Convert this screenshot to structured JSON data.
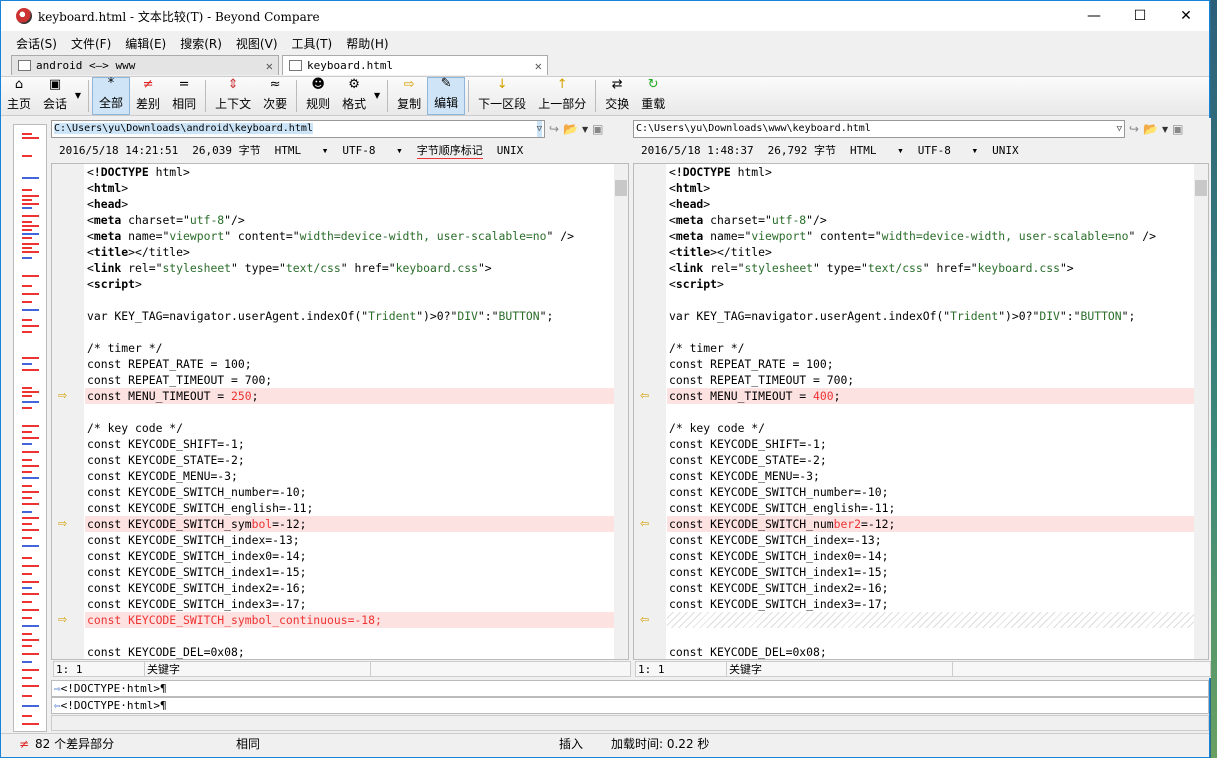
{
  "window": {
    "title": "keyboard.html - 文本比较(T) - Beyond Compare",
    "minimize": "—",
    "maximize": "☐",
    "close": "✕"
  },
  "menu": [
    "会话(S)",
    "文件(F)",
    "编辑(E)",
    "搜索(R)",
    "视图(V)",
    "工具(T)",
    "帮助(H)"
  ],
  "tabs": [
    {
      "label": "android <—> www",
      "close": "✕"
    },
    {
      "label": "keyboard.html",
      "close": "✕"
    }
  ],
  "toolbar": [
    {
      "label": "主页",
      "icon": "⌂"
    },
    {
      "label": "会话",
      "icon": "▣"
    },
    {
      "label": "全部",
      "icon": "*"
    },
    {
      "label": "差别",
      "icon": "≠"
    },
    {
      "label": "相同",
      "icon": "="
    },
    {
      "label": "上下文",
      "icon": "⇕"
    },
    {
      "label": "次要",
      "icon": "≈"
    },
    {
      "label": "规则",
      "icon": "☻"
    },
    {
      "label": "格式",
      "icon": "⚙"
    },
    {
      "label": "复制",
      "icon": "⇨"
    },
    {
      "label": "编辑",
      "icon": "✎"
    },
    {
      "label": "下一区段",
      "icon": "↓"
    },
    {
      "label": "上一部分",
      "icon": "↑"
    },
    {
      "label": "交换",
      "icon": "⇄"
    },
    {
      "label": "重载",
      "icon": "↻"
    }
  ],
  "left": {
    "path": "C:\\Users\\yu\\Downloads\\android\\keyboard.html",
    "date": "2016/5/18 14:21:51",
    "size": "26,039 字节",
    "format": "HTML",
    "encoding": "UTF-8",
    "bom": "字节顺序标记",
    "lineend": "UNIX",
    "pos": "1: 1",
    "keyword": "关键字"
  },
  "right": {
    "path": "C:\\Users\\yu\\Downloads\\www\\keyboard.html",
    "date": "2016/5/18 1:48:37",
    "size": "26,792 字节",
    "format": "HTML",
    "encoding": "UTF-8",
    "lineend": "UNIX",
    "pos": "1: 1",
    "keyword": "关键字"
  },
  "code_common": [
    "<!DOCTYPE html>",
    "<html>",
    "<head>",
    "<meta charset=\"utf-8\"/>",
    "<meta name=\"viewport\" content=\"width=device-width, user-scalable=no\" />",
    "<title></title>",
    "<link rel=\"stylesheet\" type=\"text/css\" href=\"keyboard.css\">",
    "<script>",
    "",
    "var KEY_TAG=navigator.userAgent.indexOf(\"Trident\")>0?\"DIV\":\"BUTTON\";",
    "",
    "/* timer */",
    "const REPEAT_RATE = 100;",
    "const REPEAT_TIMEOUT = 700;"
  ],
  "left_lines": [
    "const MENU_TIMEOUT = 250;",
    "",
    "/* key code */",
    "const KEYCODE_SHIFT=-1;",
    "const KEYCODE_STATE=-2;",
    "const KEYCODE_MENU=-3;",
    "const KEYCODE_SWITCH_number=-10;",
    "const KEYCODE_SWITCH_english=-11;",
    "const KEYCODE_SWITCH_symbol=-12;",
    "const KEYCODE_SWITCH_index=-13;",
    "const KEYCODE_SWITCH_index0=-14;",
    "const KEYCODE_SWITCH_index1=-15;",
    "const KEYCODE_SWITCH_index2=-16;",
    "const KEYCODE_SWITCH_index3=-17;",
    "const KEYCODE_SWITCH_symbol_continuous=-18;",
    "",
    "const KEYCODE_DEL=0x08;"
  ],
  "right_lines": [
    "const MENU_TIMEOUT = 400;",
    "",
    "/* key code */",
    "const KEYCODE_SHIFT=-1;",
    "const KEYCODE_STATE=-2;",
    "const KEYCODE_MENU=-3;",
    "const KEYCODE_SWITCH_number=-10;",
    "const KEYCODE_SWITCH_english=-11;",
    "const KEYCODE_SWITCH_number2=-12;",
    "const KEYCODE_SWITCH_index=-13;",
    "const KEYCODE_SWITCH_index0=-14;",
    "const KEYCODE_SWITCH_index1=-15;",
    "const KEYCODE_SWITCH_index2=-16;",
    "const KEYCODE_SWITCH_index3=-17;",
    "",
    "",
    "const KEYCODE_DEL=0x08;"
  ],
  "bottom": {
    "line1": "<!DOCTYPE·html>¶",
    "line2": "<!DOCTYPE·html>¶"
  },
  "status": {
    "diffs": "82 个差异部分",
    "same": "相同",
    "mode": "插入",
    "loadtime": "加载时间: 0.22 秒"
  },
  "colors": {
    "diff_bg": "#fde2e2",
    "diff_text": "#e33333",
    "string": "#2b6d2b",
    "accent": "#1883d7"
  }
}
